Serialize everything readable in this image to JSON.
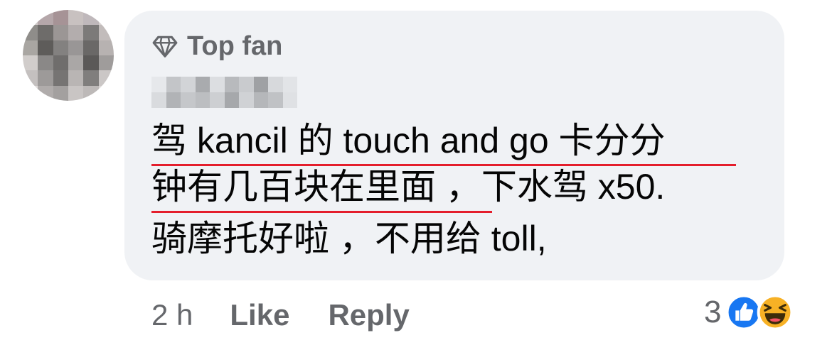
{
  "comment": {
    "badge_label": "Top fan",
    "lines": [
      "驾 kancil 的 touch and go 卡分分",
      "钟有几百块在里面 ，下水驾 x50.",
      "骑摩托好啦 ，不用给 toll,"
    ]
  },
  "footer": {
    "time": "2 h",
    "like_label": "Like",
    "reply_label": "Reply",
    "reaction_count": "3"
  },
  "colors": {
    "bubble": "#f0f2f5",
    "secondary_text": "#65676b",
    "underline": "#e41e2c",
    "like_blue": "#1877f2",
    "haha_yellow": "#f7b125"
  }
}
